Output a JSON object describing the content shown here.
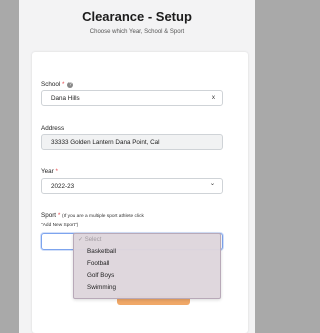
{
  "header": {
    "title": "Clearance - Setup",
    "subtitle": "Choose which Year, School & Sport"
  },
  "form": {
    "school": {
      "label": "School",
      "required_mark": "*",
      "help_icon": "question-circle-icon",
      "value": "Dana Hills",
      "clear": "x"
    },
    "address": {
      "label": "Address",
      "value": "33333 Golden Lantern Dana Point, Cal"
    },
    "year": {
      "label": "Year",
      "required_mark": "*",
      "value": "2022-23",
      "chevron": "⌄"
    },
    "sport": {
      "label": "Sport",
      "required_mark": "*",
      "hint_line1": "(If you are a multiple sport athlete click",
      "hint_line2": "\"Add New Sport\")",
      "placeholder": "Select",
      "check": "✓",
      "options": [
        "Basketball",
        "Football",
        "Golf Boys",
        "Swimming"
      ]
    }
  },
  "colors": {
    "required": "#e5484d",
    "accent_button": "#f0a868",
    "focus_border": "#7da4ee"
  }
}
